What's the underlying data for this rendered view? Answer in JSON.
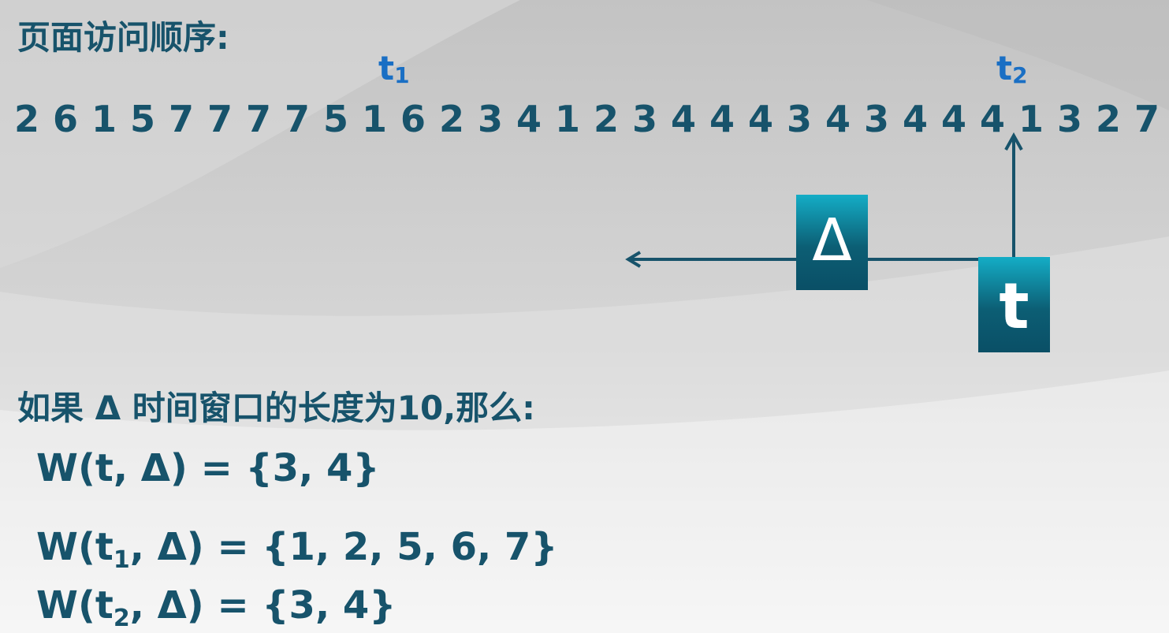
{
  "heading": "页面访问顺序:",
  "markers": {
    "t1": {
      "base": "t",
      "sub": "1"
    },
    "t2": {
      "base": "t",
      "sub": "2"
    }
  },
  "sequence": [
    "2",
    "6",
    "1",
    "5",
    "7",
    "7",
    "7",
    "7",
    "5",
    "1",
    "6",
    "2",
    "3",
    "4",
    "1",
    "2",
    "3",
    "4",
    "4",
    "4",
    "3",
    "4",
    "3",
    "4",
    "4",
    "4",
    "1",
    "3",
    "2",
    "7"
  ],
  "boxes": {
    "delta": "Δ",
    "t": "t"
  },
  "condition": "如果 Δ 时间窗口的长度为10,那么:",
  "formulas": [
    {
      "lhs": "W(t, Δ) = ",
      "rhs": " {3, 4}"
    },
    {
      "lhs_pre": "W(t",
      "lhs_sub": "1",
      "lhs_post": ", Δ) = ",
      "rhs": "{1, 2, 5, 6, 7}"
    },
    {
      "lhs_pre": "W(t",
      "lhs_sub": "2",
      "lhs_post": ", Δ) = ",
      "rhs": "{3, 4}"
    }
  ],
  "colors": {
    "text": "#17536b",
    "marker": "#1a6fc4",
    "box_top": "#14adc6",
    "box_bottom": "#0a4f66",
    "arrow": "#17536b"
  }
}
